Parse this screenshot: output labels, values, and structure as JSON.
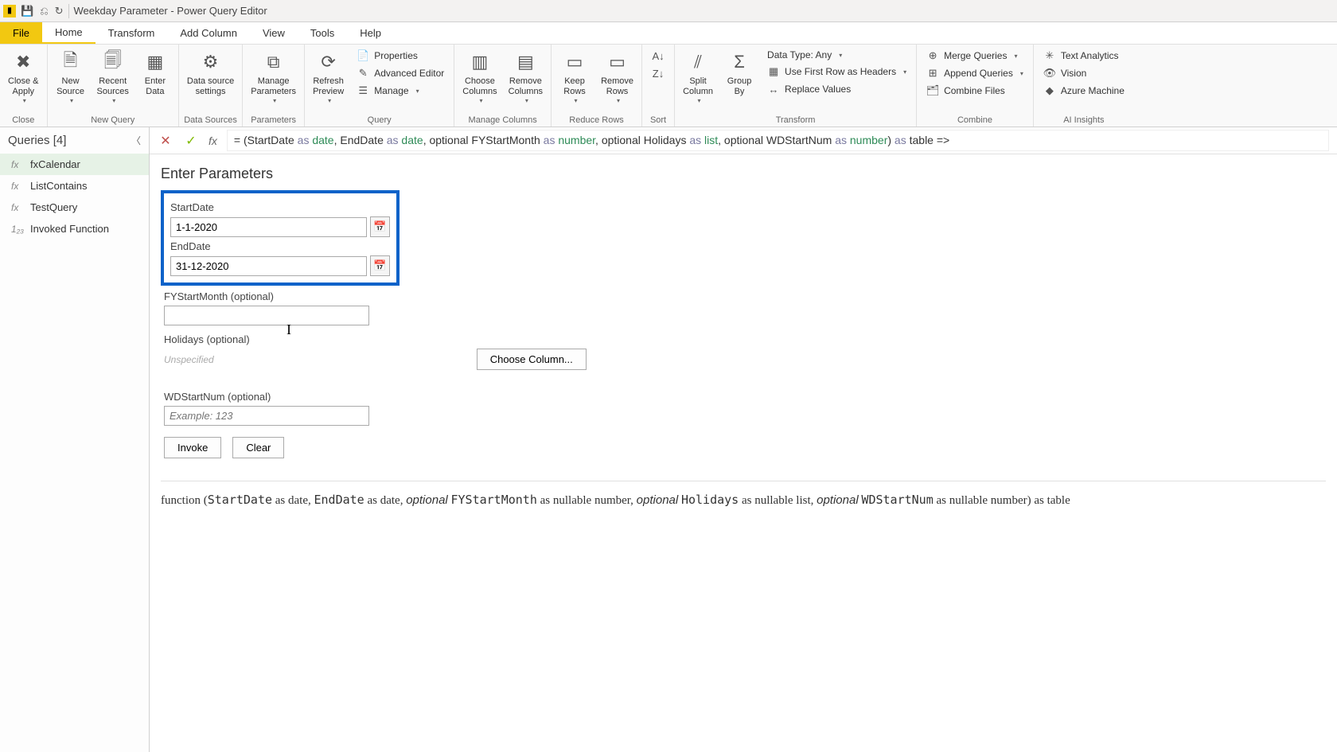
{
  "window": {
    "title": "Weekday Parameter - Power Query Editor"
  },
  "menu": {
    "file": "File",
    "tabs": [
      "Home",
      "Transform",
      "Add Column",
      "View",
      "Tools",
      "Help"
    ]
  },
  "ribbon": {
    "close": {
      "close_apply": "Close &\nApply",
      "group": "Close"
    },
    "new_query": {
      "new_source": "New\nSource",
      "recent_sources": "Recent\nSources",
      "enter_data": "Enter\nData",
      "group": "New Query"
    },
    "data_sources": {
      "settings": "Data source\nsettings",
      "group": "Data Sources"
    },
    "parameters": {
      "manage": "Manage\nParameters",
      "group": "Parameters"
    },
    "query": {
      "refresh": "Refresh\nPreview",
      "properties": "Properties",
      "adv_editor": "Advanced Editor",
      "manage": "Manage",
      "group": "Query"
    },
    "manage_cols": {
      "choose": "Choose\nColumns",
      "remove": "Remove\nColumns",
      "group": "Manage Columns"
    },
    "reduce_rows": {
      "keep": "Keep\nRows",
      "remove": "Remove\nRows",
      "group": "Reduce Rows"
    },
    "sort": {
      "group": "Sort"
    },
    "transform": {
      "split": "Split\nColumn",
      "group_by": "Group\nBy",
      "data_type": "Data Type: Any",
      "first_row": "Use First Row as Headers",
      "replace": "Replace Values",
      "group": "Transform"
    },
    "combine": {
      "merge": "Merge Queries",
      "append": "Append Queries",
      "combine_files": "Combine Files",
      "group": "Combine"
    },
    "ai": {
      "text": "Text Analytics",
      "vision": "Vision",
      "azure": "Azure Machine",
      "group": "AI Insights"
    }
  },
  "queries": {
    "header": "Queries [4]",
    "items": [
      {
        "icon": "fx",
        "name": "fxCalendar",
        "selected": true
      },
      {
        "icon": "fx",
        "name": "ListContains",
        "selected": false
      },
      {
        "icon": "fx",
        "name": "TestQuery",
        "selected": false
      },
      {
        "icon": "1₂₃",
        "name": "Invoked Function",
        "selected": false
      }
    ]
  },
  "formula": {
    "prefix": "= (StartDate ",
    "seg": [
      "as",
      " date",
      ", EndDate ",
      "as",
      " date",
      ", optional FYStartMonth ",
      "as",
      " number",
      ", optional Holidays ",
      "as",
      " list",
      ", optional WDStartNum ",
      "as",
      " number",
      ") ",
      "as",
      " table =>"
    ]
  },
  "params": {
    "title": "Enter Parameters",
    "start_label": "StartDate",
    "start_value": "1-1-2020",
    "end_label": "EndDate",
    "end_value": "31-12-2020",
    "fy_label": "FYStartMonth (optional)",
    "fy_value": "",
    "holidays_label": "Holidays (optional)",
    "holidays_placeholder": "Unspecified",
    "choose_column": "Choose Column...",
    "wd_label": "WDStartNum (optional)",
    "wd_placeholder": "Example: 123",
    "invoke": "Invoke",
    "clear": "Clear"
  },
  "signature": "function (StartDate as date, EndDate as date, optional FYStartMonth as nullable number, optional Holidays as nullable list, optional WDStartNum as nullable number) as table"
}
